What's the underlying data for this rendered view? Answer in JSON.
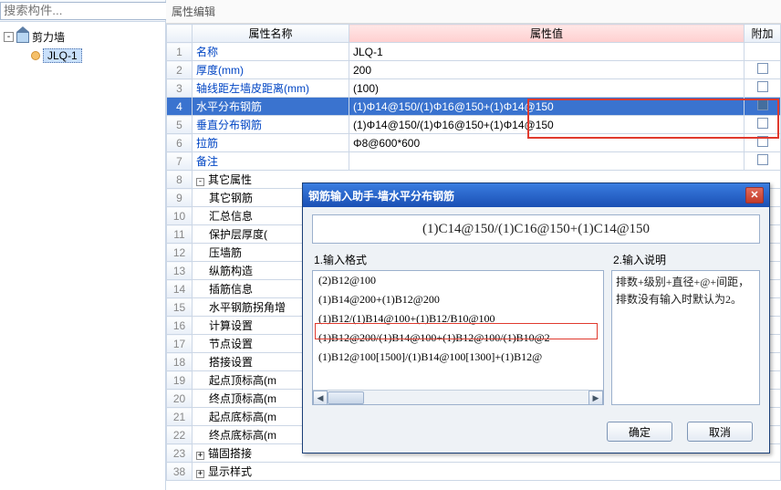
{
  "search": {
    "placeholder": "搜索构件...",
    "icon": "search-icon"
  },
  "tree": {
    "root_label": "剪力墙",
    "selected_label": "JLQ-1"
  },
  "panel": {
    "title": "属性编辑",
    "cols": {
      "name": "属性名称",
      "value": "属性值",
      "extra": "附加"
    }
  },
  "rows": [
    {
      "n": "1",
      "name": "名称",
      "value": "JLQ-1",
      "chk": false,
      "link": true
    },
    {
      "n": "2",
      "name": "厚度(mm)",
      "value": "200",
      "chk": true,
      "link": true
    },
    {
      "n": "3",
      "name": "轴线距左墙皮距离(mm)",
      "value": "(100)",
      "chk": true,
      "link": true
    },
    {
      "n": "4",
      "name": "水平分布钢筋",
      "value": "(1)Φ14@150/(1)Φ16@150+(1)Φ14@150",
      "chk": true,
      "link": true,
      "sel": true
    },
    {
      "n": "5",
      "name": "垂直分布钢筋",
      "value": "(1)Φ14@150/(1)Φ16@150+(1)Φ14@150",
      "chk": true,
      "link": true
    },
    {
      "n": "6",
      "name": "拉筋",
      "value": "Φ8@600*600",
      "chk": true,
      "link": true
    },
    {
      "n": "7",
      "name": "备注",
      "value": "",
      "chk": true,
      "link": true
    },
    {
      "n": "8",
      "name": "其它属性",
      "value": "",
      "group": true,
      "open": true
    },
    {
      "n": "9",
      "name": "其它钢筋",
      "value": "",
      "indent": true
    },
    {
      "n": "10",
      "name": "汇总信息",
      "value": "",
      "indent": true
    },
    {
      "n": "11",
      "name": "保护层厚度(",
      "value": "",
      "indent": true
    },
    {
      "n": "12",
      "name": "压墙筋",
      "value": "",
      "indent": true
    },
    {
      "n": "13",
      "name": "纵筋构造",
      "value": "",
      "indent": true
    },
    {
      "n": "14",
      "name": "插筋信息",
      "value": "",
      "indent": true
    },
    {
      "n": "15",
      "name": "水平钢筋拐角增",
      "value": "",
      "indent": true
    },
    {
      "n": "16",
      "name": "计算设置",
      "value": "",
      "indent": true
    },
    {
      "n": "17",
      "name": "节点设置",
      "value": "",
      "indent": true
    },
    {
      "n": "18",
      "name": "搭接设置",
      "value": "",
      "indent": true
    },
    {
      "n": "19",
      "name": "起点顶标高(m",
      "value": "",
      "indent": true
    },
    {
      "n": "20",
      "name": "终点顶标高(m",
      "value": "",
      "indent": true
    },
    {
      "n": "21",
      "name": "起点底标高(m",
      "value": "",
      "indent": true
    },
    {
      "n": "22",
      "name": "终点底标高(m",
      "value": "",
      "indent": true
    },
    {
      "n": "23",
      "name": "锚固搭接",
      "value": "",
      "group": true,
      "open": false
    },
    {
      "n": "38",
      "name": "显示样式",
      "value": "",
      "group": true,
      "open": false
    }
  ],
  "dialog": {
    "title": "钢筋输入助手-墙水平分布钢筋",
    "formula": "(1)C14@150/(1)C16@150+(1)C14@150",
    "left_label": "1.输入格式",
    "right_label": "2.输入说明",
    "list": [
      "(2)B12@100",
      "(1)B14@200+(1)B12@200",
      "(1)B12/(1)B14@100+(1)B12/B10@100",
      "(1)B12@200/(1)B14@100+(1)B12@100/(1)B10@2",
      "(1)B12@100[1500]/(1)B14@100[1300]+(1)B12@"
    ],
    "desc": "排数+级别+直径+@+间距，排数没有输入时默认为2。",
    "ok": "确定",
    "cancel": "取消"
  }
}
